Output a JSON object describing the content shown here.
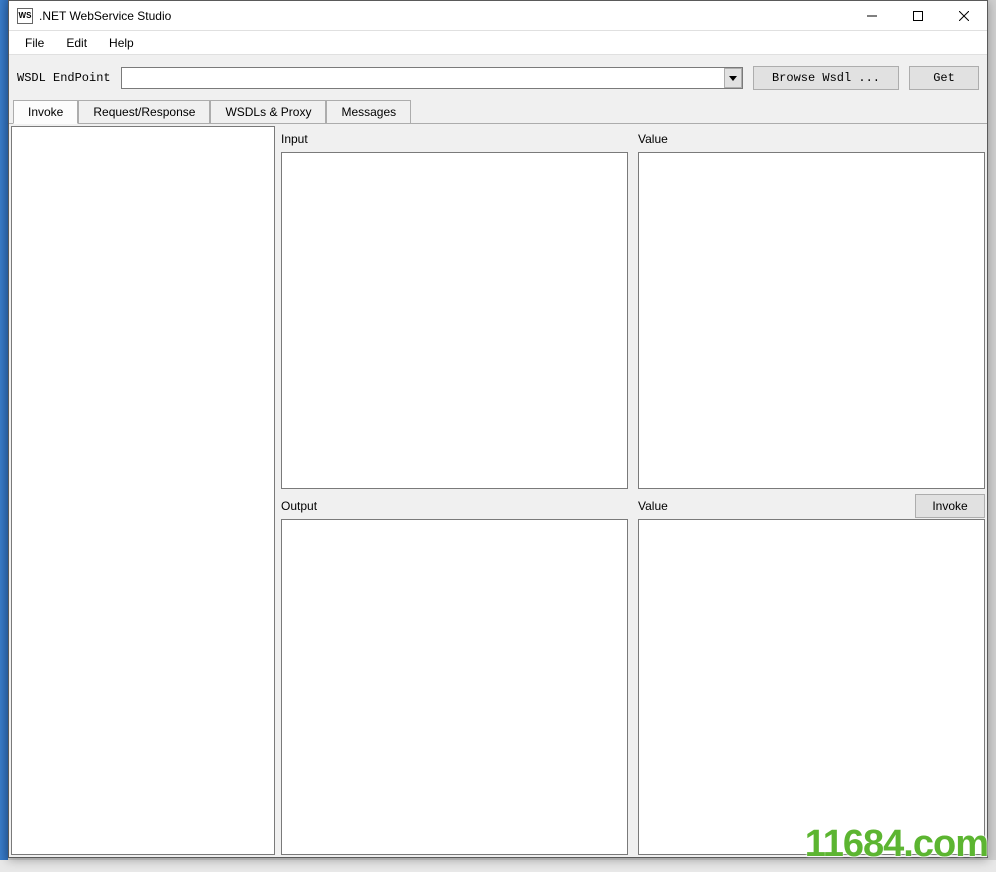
{
  "titlebar": {
    "icon_text": "WS",
    "title": ".NET WebService Studio"
  },
  "menu": {
    "file": "File",
    "edit": "Edit",
    "help": "Help"
  },
  "toolbar": {
    "endpoint_label": "WSDL EndPoint",
    "endpoint_value": "",
    "browse_label": "Browse Wsdl ...",
    "get_label": "Get"
  },
  "tabs": {
    "invoke": "Invoke",
    "request_response": "Request/Response",
    "wsdls_proxy": "WSDLs & Proxy",
    "messages": "Messages"
  },
  "panels": {
    "input_label": "Input",
    "value1_label": "Value",
    "output_label": "Output",
    "value2_label": "Value",
    "invoke_btn": "Invoke"
  },
  "watermark": "11684.com"
}
